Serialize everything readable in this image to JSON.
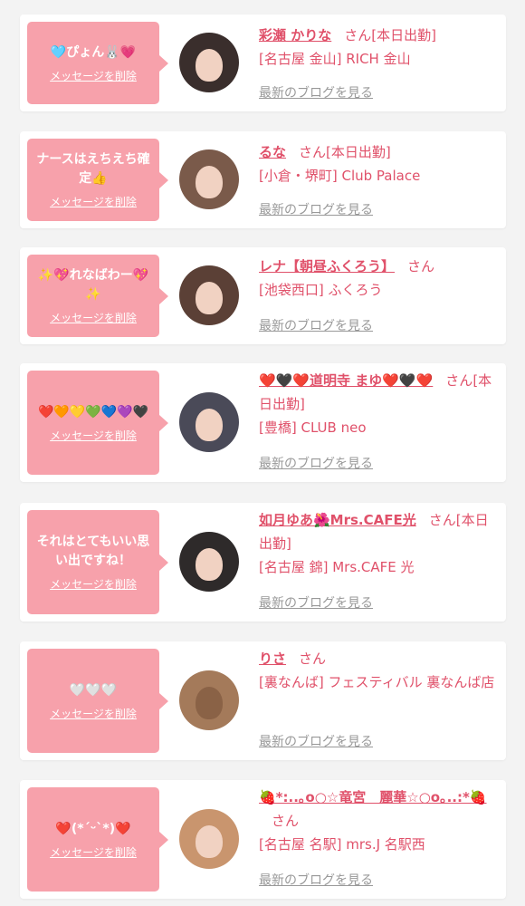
{
  "colors": {
    "bubble": "#f7a1ab",
    "accent": "#e0516a",
    "muted": "#999999",
    "card": "#ffffff",
    "background": "#f3f3f3"
  },
  "entries": [
    {
      "message": "🩵ぴょん🐰💗",
      "delete_label": "メッセージを削除",
      "name": "彩瀬 かりな",
      "san": "さん",
      "status": "[本日出勤]",
      "shop": "[名古屋 金山] RICH 金山",
      "blog_label": "最新のブログを見る"
    },
    {
      "message": "ナースはえちえち確定👍",
      "delete_label": "メッセージを削除",
      "name": "るな",
      "san": "さん",
      "status": "[本日出勤]",
      "shop": "[小倉・堺町] Club Palace",
      "blog_label": "最新のブログを見る"
    },
    {
      "message": "✨💖れなばわー💖✨",
      "delete_label": "メッセージを削除",
      "name": "レナ【朝昼ふくろう】",
      "san": "さん",
      "status": "",
      "shop": "[池袋西口] ふくろう",
      "blog_label": "最新のブログを見る"
    },
    {
      "message": "❤️🧡💛💚💙💜🖤",
      "delete_label": "メッセージを削除",
      "name": "❤️🖤❤️道明寺 まゆ❤️🖤❤️",
      "san": "さん",
      "status": "[本日出勤]",
      "shop": "[豊橋] CLUB neo",
      "blog_label": "最新のブログを見る"
    },
    {
      "message": "それはとてもいい思い出ですね！",
      "delete_label": "メッセージを削除",
      "name": "如月ゆあ🌺Mrs.CAFE光",
      "san": "さん",
      "status": "[本日出勤]",
      "shop": "[名古屋 錦] Mrs.CAFE 光",
      "blog_label": "最新のブログを見る"
    },
    {
      "message": "🤍🤍🤍",
      "delete_label": "メッセージを削除",
      "name": "りさ",
      "san": "さん",
      "status": "",
      "shop": "[裏なんば] フェスティバル 裏なんば店",
      "blog_label": "最新のブログを見る"
    },
    {
      "message": "❤️(*ˊᵕˋ*)❤️",
      "delete_label": "メッセージを削除",
      "name": "🍓*:..｡o○☆竜宮　麗華☆○o｡..:*🍓",
      "san": "さん",
      "status": "",
      "shop": "[名古屋 名駅] mrs.J 名駅西",
      "blog_label": "最新のブログを見る"
    }
  ]
}
